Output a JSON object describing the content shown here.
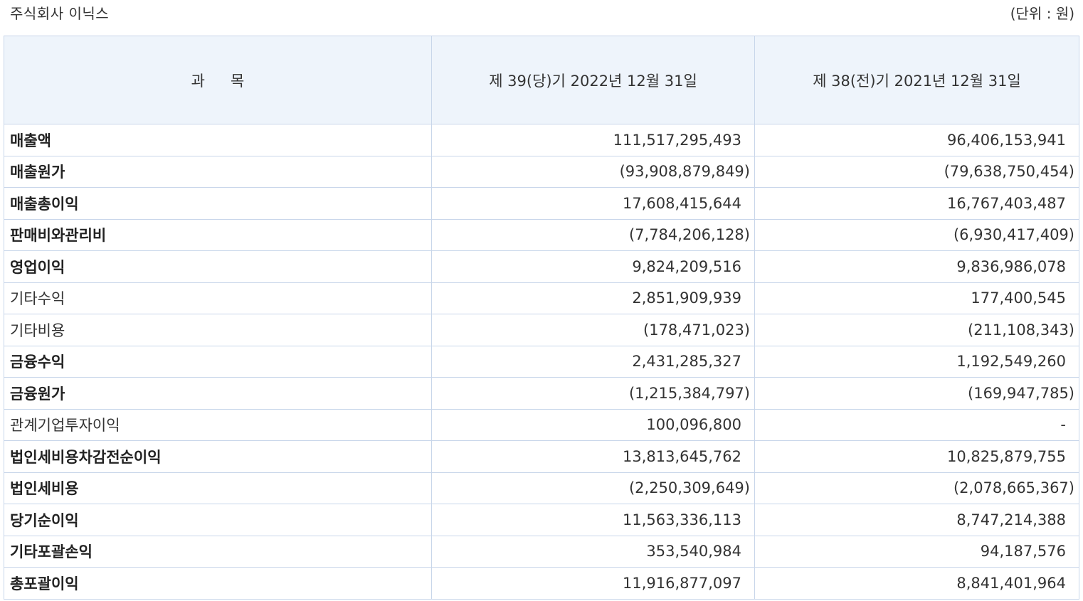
{
  "header": {
    "company": "주식회사 이닉스",
    "unit": "(단위 : 원)"
  },
  "table": {
    "columns": {
      "subject_a": "과",
      "subject_b": "목",
      "current": "제 39(당)기 2022년 12월 31일",
      "previous": "제 38(전)기 2021년 12월 31일"
    },
    "rows": [
      {
        "label": "매출액",
        "bold": true,
        "current": "111,517,295,493",
        "previous": "96,406,153,941"
      },
      {
        "label": "매출원가",
        "bold": true,
        "current": "(93,908,879,849)",
        "previous": "(79,638,750,454)"
      },
      {
        "label": "매출총이익",
        "bold": true,
        "current": "17,608,415,644",
        "previous": "16,767,403,487"
      },
      {
        "label": "판매비와관리비",
        "bold": true,
        "current": "(7,784,206,128)",
        "previous": "(6,930,417,409)"
      },
      {
        "label": "영업이익",
        "bold": true,
        "current": "9,824,209,516",
        "previous": "9,836,986,078"
      },
      {
        "label": "기타수익",
        "bold": false,
        "current": "2,851,909,939",
        "previous": "177,400,545"
      },
      {
        "label": "기타비용",
        "bold": false,
        "current": "(178,471,023)",
        "previous": "(211,108,343)"
      },
      {
        "label": "금융수익",
        "bold": true,
        "current": "2,431,285,327",
        "previous": "1,192,549,260"
      },
      {
        "label": "금융원가",
        "bold": true,
        "current": "(1,215,384,797)",
        "previous": "(169,947,785)"
      },
      {
        "label": "관계기업투자이익",
        "bold": false,
        "current": "100,096,800",
        "previous": "-"
      },
      {
        "label": "법인세비용차감전순이익",
        "bold": true,
        "current": "13,813,645,762",
        "previous": "10,825,879,755"
      },
      {
        "label": "법인세비용",
        "bold": true,
        "current": "(2,250,309,649)",
        "previous": "(2,078,665,367)"
      },
      {
        "label": "당기순이익",
        "bold": true,
        "current": "11,563,336,113",
        "previous": "8,747,214,388"
      },
      {
        "label": "기타포괄손익",
        "bold": true,
        "current": "353,540,984",
        "previous": "94,187,576"
      },
      {
        "label": "총포괄이익",
        "bold": true,
        "current": "11,916,877,097",
        "previous": "8,841,401,964"
      }
    ]
  }
}
